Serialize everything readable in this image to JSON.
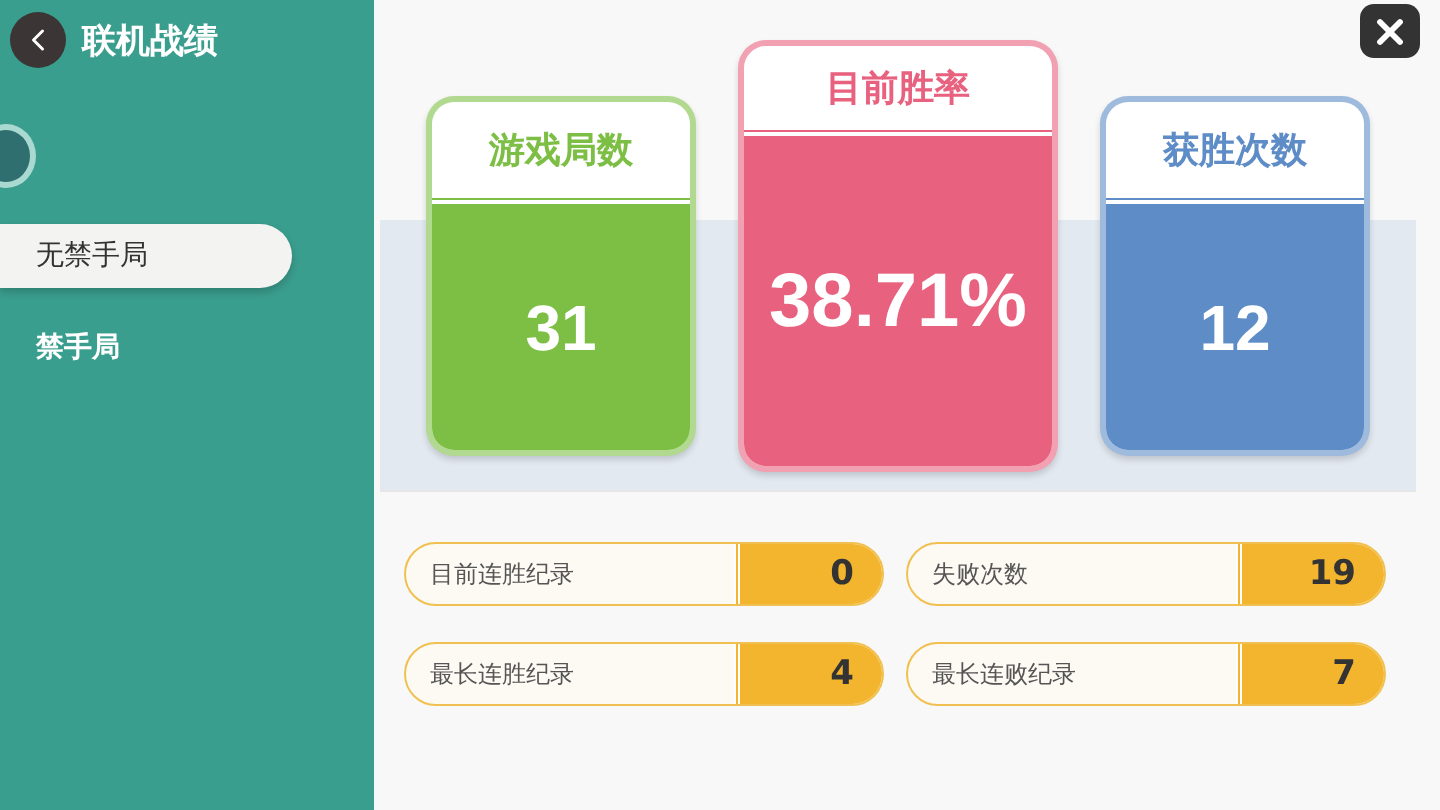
{
  "header": {
    "title": "联机战绩"
  },
  "sidebar": {
    "items": [
      {
        "label": "无禁手局",
        "selected": true
      },
      {
        "label": "禁手局",
        "selected": false
      }
    ]
  },
  "cards": [
    {
      "label": "游戏局数",
      "value": "31",
      "color": "#7dbf45",
      "featured": false
    },
    {
      "label": "目前胜率",
      "value": "38.71%",
      "color": "#e8627f",
      "featured": true
    },
    {
      "label": "获胜次数",
      "value": "12",
      "color": "#5d8cc6",
      "featured": false
    }
  ],
  "stats": [
    {
      "label": "目前连胜纪录",
      "value": "0"
    },
    {
      "label": "失败次数",
      "value": "19"
    },
    {
      "label": "最长连胜纪录",
      "value": "4"
    },
    {
      "label": "最长连败纪录",
      "value": "7"
    }
  ]
}
